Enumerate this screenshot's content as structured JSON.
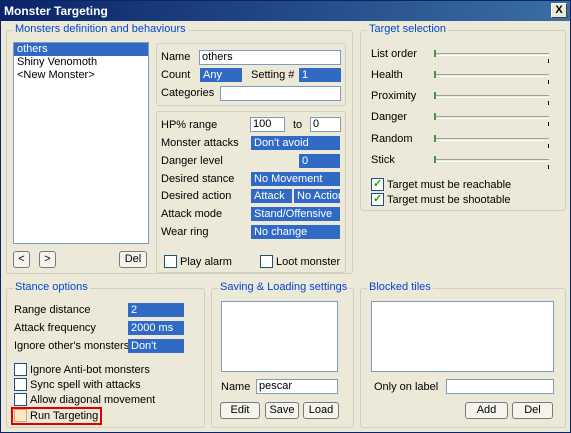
{
  "window": {
    "title": "Monster Targeting",
    "close_symbol": "X"
  },
  "monsters": {
    "title": "Monsters definition and behaviours",
    "list": [
      "others",
      "Shiny Venomoth",
      "<New Monster>"
    ],
    "prev_symbol": "<",
    "next_symbol": ">",
    "del_label": "Del",
    "name_label": "Name",
    "name_value": "others",
    "count_label": "Count",
    "count_value": "Any",
    "setting_label": "Setting #",
    "setting_value": "1",
    "categories_label": "Categories",
    "categories_value": "",
    "hp_label": "HP% range",
    "hp_from": "100",
    "hp_to_label": "to",
    "hp_to": "0",
    "attacks_label": "Monster attacks",
    "attacks_value": "Don't avoid",
    "danger_label": "Danger level",
    "danger_value": "0",
    "stance_label": "Desired stance",
    "stance_value": "No Movement",
    "action_label": "Desired action",
    "action_value1": "Attack",
    "action_value2": "No Action",
    "mode_label": "Attack mode",
    "mode_value": "Stand/Offensive",
    "ring_label": "Wear ring",
    "ring_value": "No change",
    "play_alarm_label": "Play alarm",
    "loot_label": "Loot monster"
  },
  "target": {
    "title": "Target selection",
    "sliders": [
      {
        "label": "List order",
        "level": 0
      },
      {
        "label": "Health",
        "level": 0
      },
      {
        "label": "Proximity",
        "level": 0
      },
      {
        "label": "Danger",
        "level": 0
      },
      {
        "label": "Random",
        "level": 0
      },
      {
        "label": "Stick",
        "level": 0
      }
    ],
    "reachable_label": "Target must be reachable",
    "shootable_label": "Target must be shootable"
  },
  "stance": {
    "title": "Stance options",
    "range_label": "Range distance",
    "range_value": "2",
    "freq_label": "Attack frequency",
    "freq_value": "2000 ms",
    "ignore_label": "Ignore other's monsters",
    "ignore_value": "Don't",
    "antibot_label": "Ignore Anti-bot monsters",
    "sync_label": "Sync spell with attacks",
    "diag_label": "Allow diagonal movement",
    "run_label": "Run Targeting"
  },
  "saving": {
    "title": "Saving & Loading settings",
    "name_label": "Name",
    "name_value": "pescar",
    "edit_label": "Edit",
    "save_label": "Save",
    "load_label": "Load"
  },
  "blocked": {
    "title": "Blocked tiles",
    "only_label": "Only on label",
    "only_value": "",
    "add_label": "Add",
    "del_label": "Del"
  }
}
